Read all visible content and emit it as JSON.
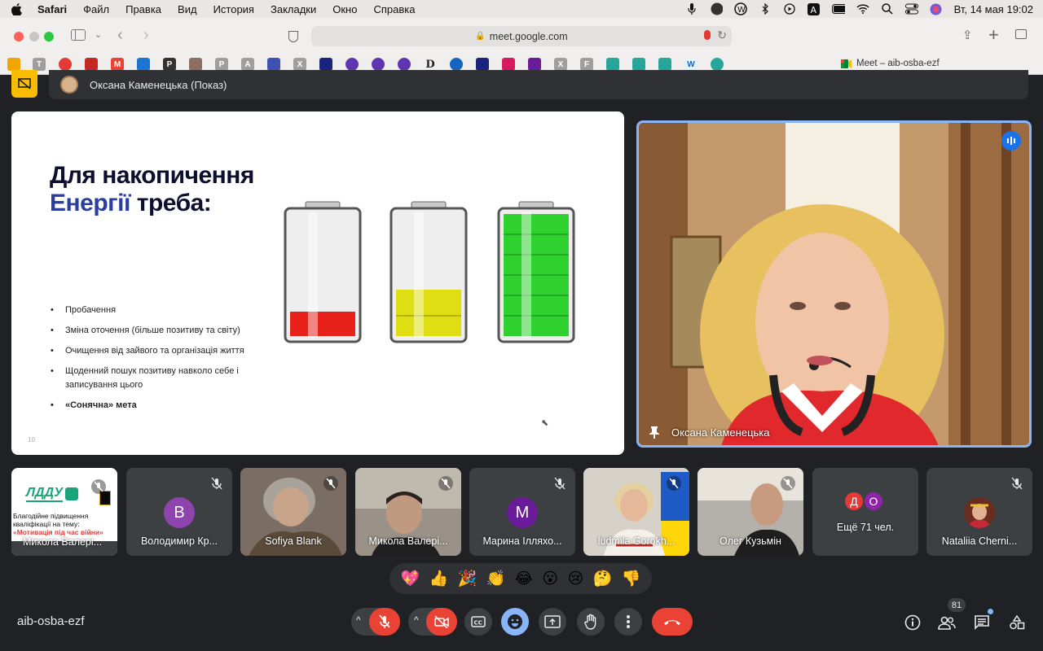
{
  "menubar": {
    "app": "Safari",
    "items": [
      "Файл",
      "Правка",
      "Вид",
      "История",
      "Закладки",
      "Окно",
      "Справка"
    ],
    "datetime": "Вт, 14 мая  19:02"
  },
  "browser": {
    "url": "meet.google.com",
    "tab_title": "Meet – aib-osba-ezf",
    "bookmark_letters": [
      "T",
      "P",
      "P",
      "A",
      "X",
      "D",
      "X",
      "F"
    ]
  },
  "presentation": {
    "presenter": "Оксана Каменецька (Показ)"
  },
  "slide": {
    "title_line1": "Для накопичення",
    "title_word_blue": "Енергії",
    "title_rest": " треба:",
    "bullets": [
      "Пробачення",
      "Зміна оточення (більше позитиву та світу)",
      "Очищення від зайвого та організація життя",
      "Щоденний пошук позитиву навколо себе і записування цього",
      "«Сонячна» мета"
    ],
    "page_number": "10",
    "battery_levels": [
      0.2,
      0.38,
      1.0
    ],
    "battery_colors": [
      "#e8211a",
      "#dede12",
      "#2fd12f"
    ]
  },
  "speaker": {
    "name": "Оксана Каменецька"
  },
  "tiles": [
    {
      "name": "Микола Валері...",
      "logo_text": "ЛДДУ",
      "banner_line1": "Благодійне підвищення",
      "banner_line2": "кваліфікації на тему:",
      "banner_line3": "«Мотивація під час війни»"
    },
    {
      "name": "Володимир Кр...",
      "initial": "В",
      "color": "#8e44ad"
    },
    {
      "name": "Sofiya Blank"
    },
    {
      "name": "Микола Валері..."
    },
    {
      "name": "Марина Ілляхо...",
      "initial": "М",
      "color": "#6a1b9a"
    },
    {
      "name": "ludmila Gorokh..."
    },
    {
      "name": "Олег Кузьмін"
    },
    {
      "name": "Ещё 71 чел.",
      "initials": [
        "Д",
        "О"
      ]
    },
    {
      "name": "Nataliia Cherni..."
    }
  ],
  "reactions": [
    "💖",
    "👍",
    "🎉",
    "👏",
    "😂",
    "😮",
    "😢",
    "🤔",
    "👎"
  ],
  "meeting_code": "aib-osba-ezf",
  "participants_count": "81"
}
